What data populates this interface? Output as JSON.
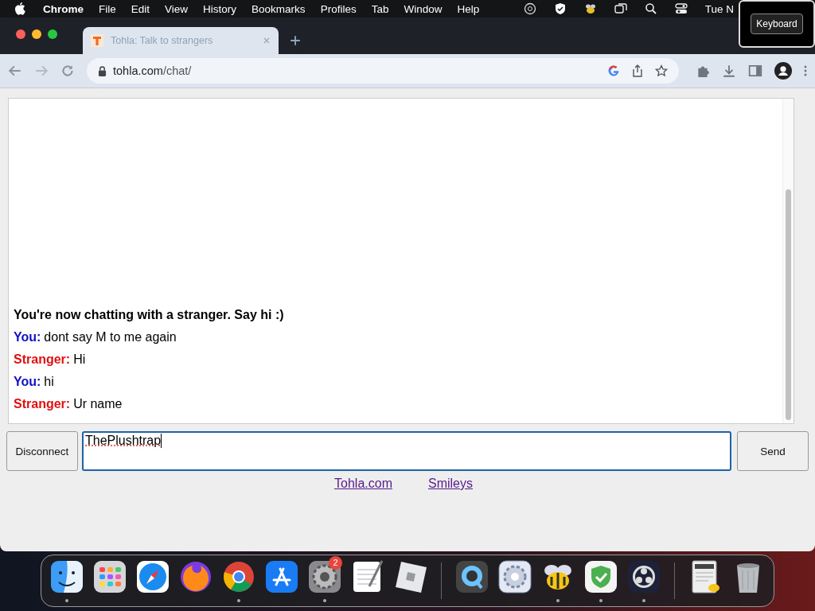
{
  "menu_bar": {
    "app": "Chrome",
    "items": [
      "File",
      "Edit",
      "View",
      "History",
      "Bookmarks",
      "Profiles",
      "Tab",
      "Window",
      "Help"
    ],
    "clock": "Tue N"
  },
  "keyboard_popup": {
    "label": "Keyboard"
  },
  "browser": {
    "tabs": [
      {
        "title": "Tohla: Talk to strangers",
        "selected": true
      }
    ],
    "address": {
      "host": "tohla.com",
      "path": "/chat/"
    }
  },
  "chat": {
    "messages": [
      {
        "kind": "system",
        "text": "You're now chatting with a stranger. Say hi :)"
      },
      {
        "kind": "you",
        "speaker": "You:",
        "text": "dont say M to me again"
      },
      {
        "kind": "stranger",
        "speaker": "Stranger:",
        "text": "Hi"
      },
      {
        "kind": "you",
        "speaker": "You:",
        "text": "hi"
      },
      {
        "kind": "stranger",
        "speaker": "Stranger:",
        "text": "Ur name"
      }
    ],
    "disconnect_button": "Disconnect",
    "message_value": "ThePlushtrap",
    "send_button": "Send",
    "links": [
      "Tohla.com",
      "Smileys"
    ]
  },
  "dock": {
    "items": [
      {
        "running": true
      },
      {
        "running": false
      },
      {
        "running": false
      },
      {
        "running": false
      },
      {
        "running": true
      },
      {
        "running": false
      },
      {
        "running": true,
        "badge": "2"
      },
      {
        "running": false
      },
      {
        "running": false
      },
      {
        "running": false
      },
      {
        "running": false
      },
      {
        "running": true
      },
      {
        "running": true
      },
      {
        "running": true
      },
      {
        "running": false
      },
      {
        "running": false
      }
    ]
  }
}
